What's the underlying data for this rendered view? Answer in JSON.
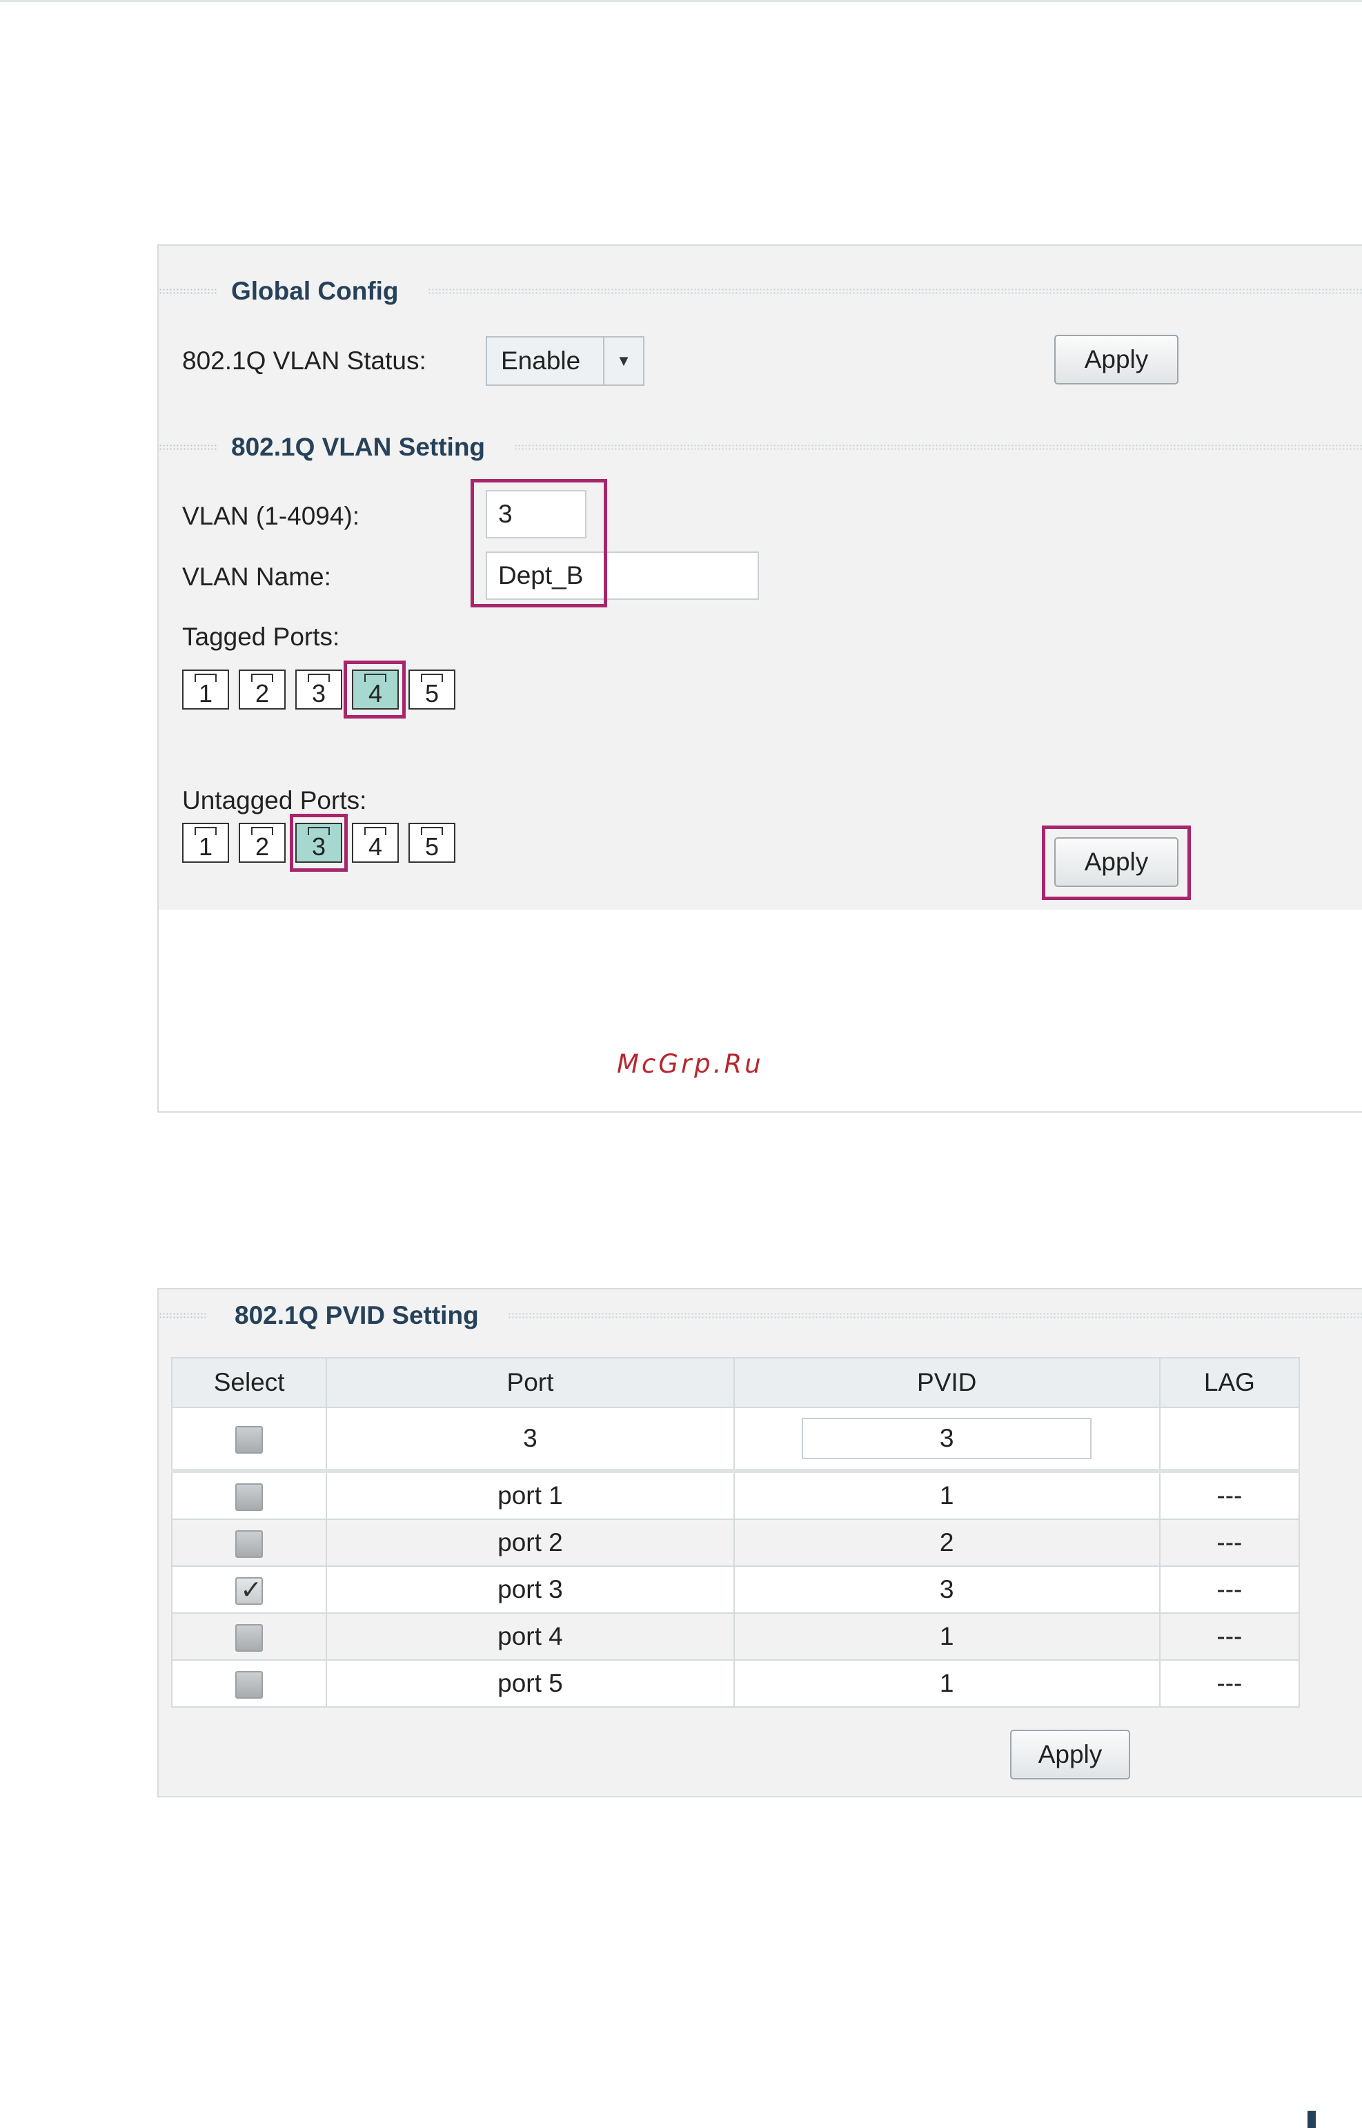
{
  "global_config": {
    "title": "Global Config",
    "status_label": "802.1Q VLAN Status:",
    "status_value": "Enable",
    "apply_label": "Apply"
  },
  "vlan_setting": {
    "title": "802.1Q VLAN Setting",
    "vlan_id_label": "VLAN (1-4094):",
    "vlan_id_value": "3",
    "vlan_name_label": "VLAN Name:",
    "vlan_name_value": "Dept_B",
    "tagged_label": "Tagged Ports:",
    "tagged_ports": [
      "1",
      "2",
      "3",
      "4",
      "5"
    ],
    "tagged_selected": [
      "4"
    ],
    "untagged_label": "Untagged Ports:",
    "untagged_ports": [
      "1",
      "2",
      "3",
      "4",
      "5"
    ],
    "untagged_selected": [
      "3"
    ],
    "apply_label": "Apply",
    "watermark": "McGrp.Ru"
  },
  "pvid_setting": {
    "title": "802.1Q PVID Setting",
    "headers": [
      "Select",
      "Port",
      "PVID",
      "LAG"
    ],
    "edit_row": {
      "port": "3",
      "pvid": "3"
    },
    "rows": [
      {
        "port": "port 1",
        "pvid": "1",
        "lag": "---",
        "checked": false
      },
      {
        "port": "port 2",
        "pvid": "2",
        "lag": "---",
        "checked": false
      },
      {
        "port": "port 3",
        "pvid": "3",
        "lag": "---",
        "checked": true
      },
      {
        "port": "port 4",
        "pvid": "1",
        "lag": "---",
        "checked": false
      },
      {
        "port": "port 5",
        "pvid": "1",
        "lag": "---",
        "checked": false
      }
    ],
    "apply_label": "Apply"
  },
  "colors": {
    "section_title": "#26415a",
    "highlight": "#a8266b",
    "port_selected": "#a6d8cf",
    "watermark": "#b8272e"
  }
}
